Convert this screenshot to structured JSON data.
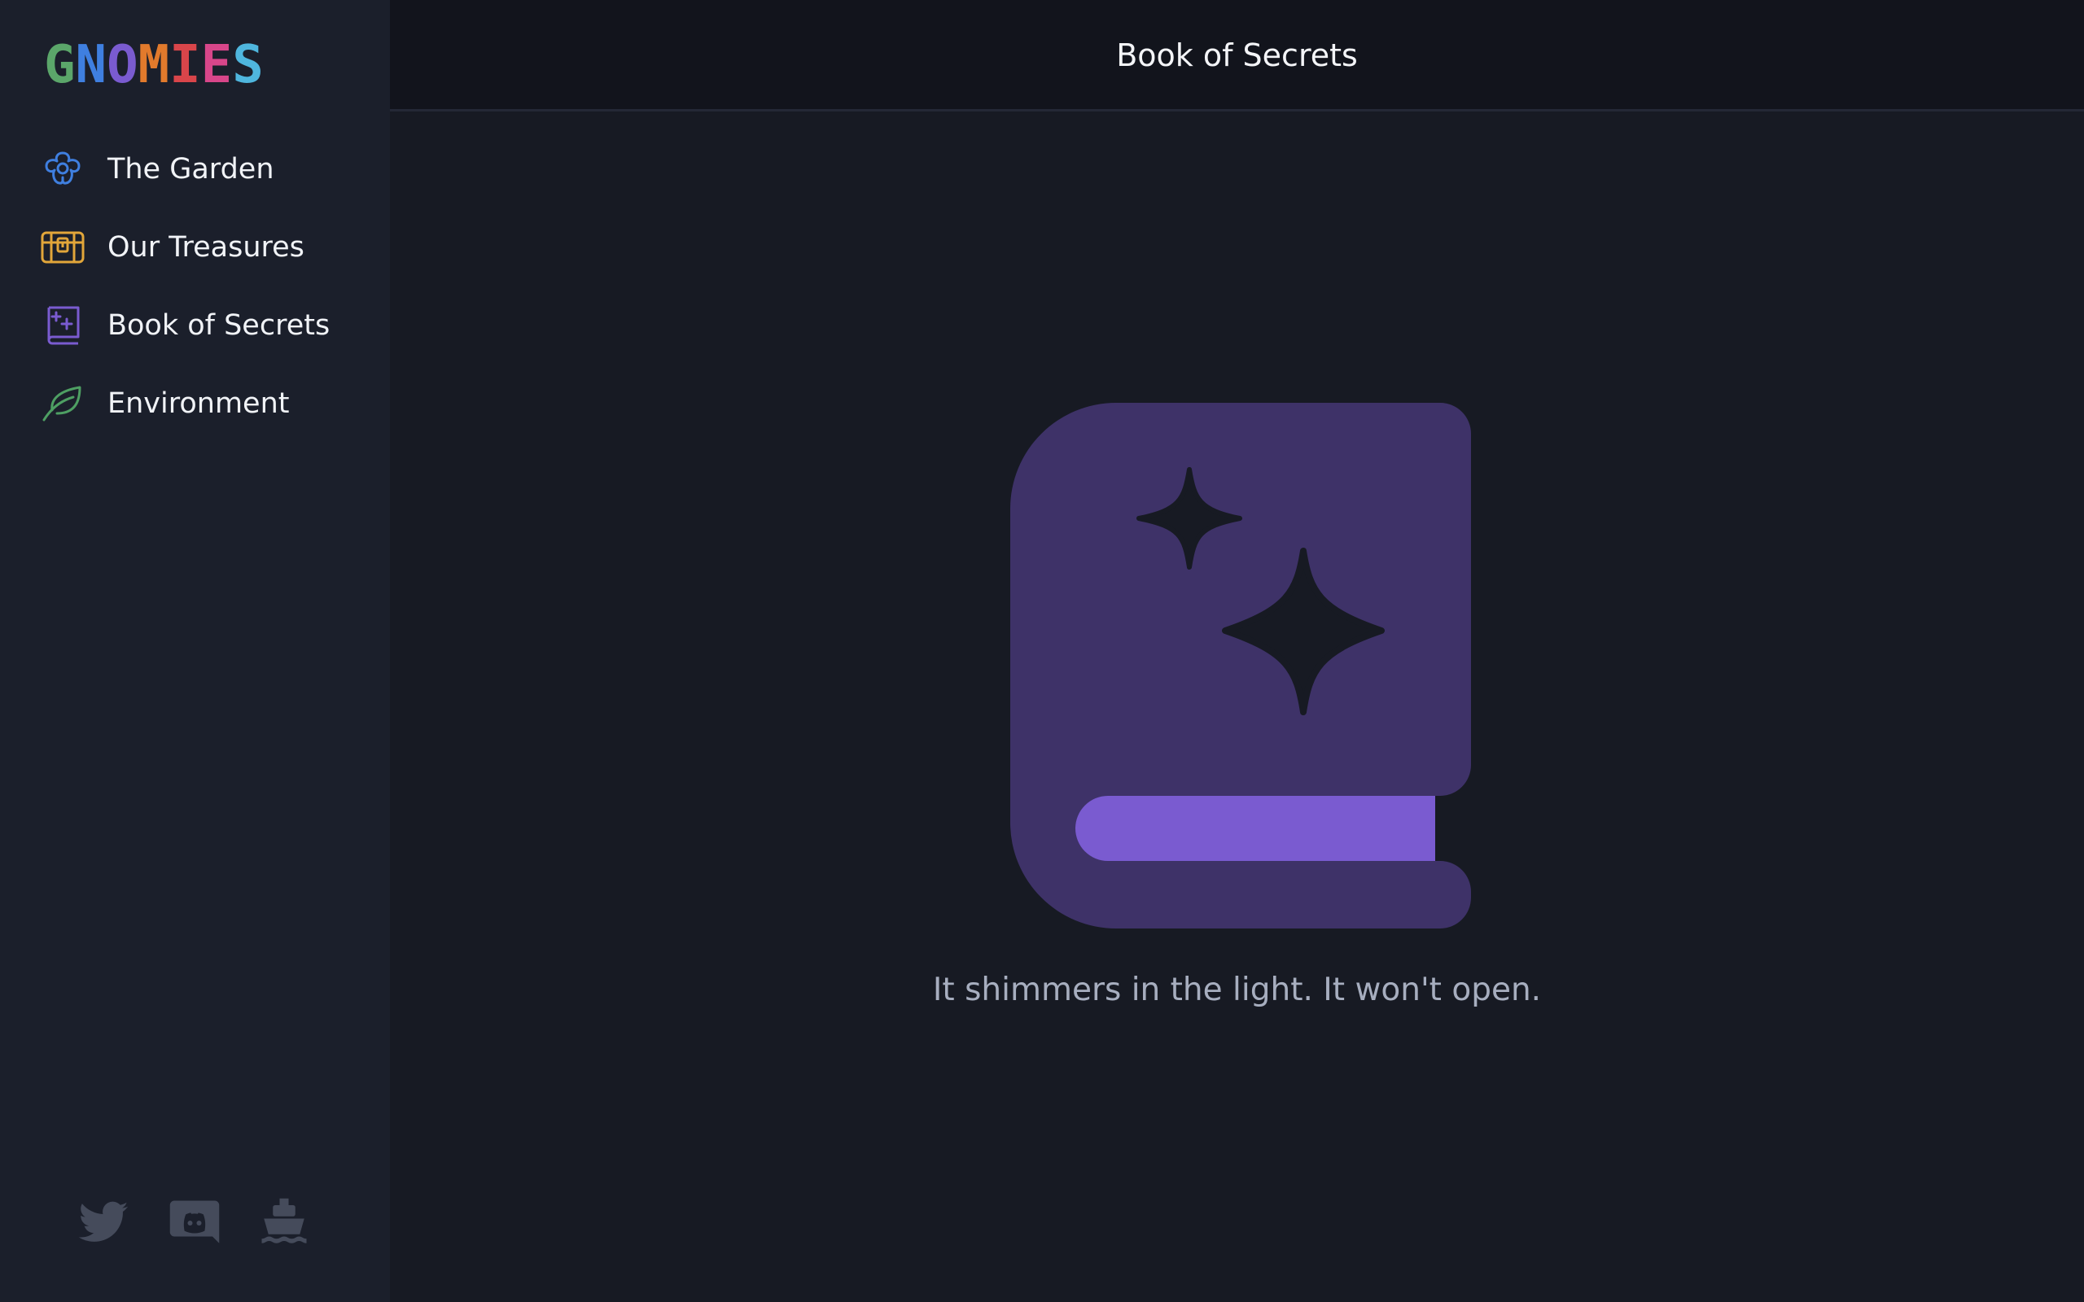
{
  "app": {
    "logo_text": "GNOMIES",
    "logo_letters": [
      {
        "char": "G",
        "color": "#5ba66a"
      },
      {
        "char": "N",
        "color": "#3f7fe0"
      },
      {
        "char": "O",
        "color": "#7a5bd0"
      },
      {
        "char": "M",
        "color": "#e27a2c"
      },
      {
        "char": "I",
        "color": "#d9454a"
      },
      {
        "char": "E",
        "color": "#d8468a"
      },
      {
        "char": "S",
        "color": "#4fb6de"
      }
    ]
  },
  "sidebar": {
    "items": [
      {
        "label": "The Garden",
        "icon": "flower-icon",
        "color": "#3f7fe0"
      },
      {
        "label": "Our Treasures",
        "icon": "treasure-chest-icon",
        "color": "#e2a63a"
      },
      {
        "label": "Book of Secrets",
        "icon": "sparkle-book-icon",
        "color": "#7a5bd0"
      },
      {
        "label": "Environment",
        "icon": "leaf-icon",
        "color": "#4e9f63"
      }
    ],
    "socials": [
      {
        "icon": "twitter-icon"
      },
      {
        "icon": "discord-icon"
      },
      {
        "icon": "boat-icon"
      }
    ]
  },
  "header": {
    "title": "Book of Secrets"
  },
  "main": {
    "illustration": "locked-sparkle-book-icon",
    "caption": "It shimmers in the light. It won't open."
  },
  "colors": {
    "background": "#171a23",
    "sidebar": "#1b1f2b",
    "topbar": "#12141c",
    "book_cover": "#3e3268",
    "book_pages": "#7a5bd0",
    "social_icon": "#454b5b"
  }
}
